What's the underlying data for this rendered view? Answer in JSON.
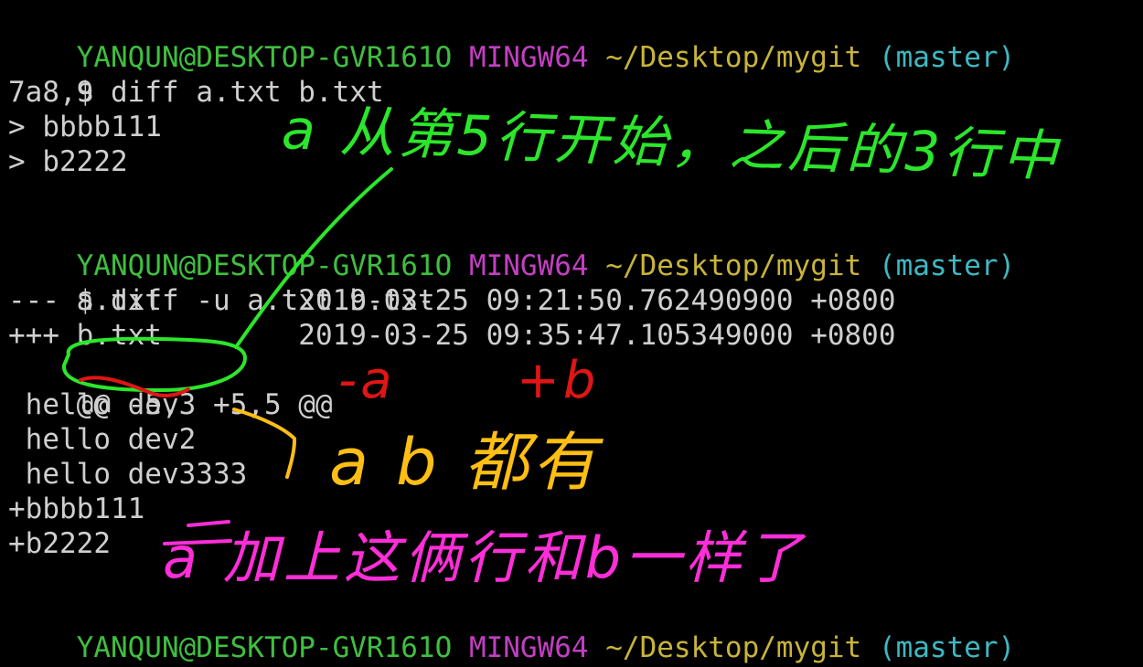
{
  "prompt": {
    "user_host": "YANQUN@DESKTOP-GVR161O",
    "system": "MINGW64",
    "path": "~/Desktop/mygit",
    "branch": "(master)",
    "symbol": "$"
  },
  "commands": {
    "cmd1": "diff a.txt b.txt",
    "cmd2": "diff -u a.txt b.txt"
  },
  "output1": {
    "line1": "7a8,9",
    "line2": "> bbbb111",
    "line3": "> b2222"
  },
  "output2": {
    "header_a": "--- a.txt        2019-03-25 09:21:50.762490900 +0800",
    "header_b": "+++ b.txt        2019-03-25 09:35:47.105349000 +0800",
    "hunk_prefix": "@@ ",
    "hunk_range": "-5,3 +5,5",
    "hunk_suffix": " @@",
    "ctx1": " hello dev",
    "ctx2": " hello dev2",
    "ctx3": " hello dev3333",
    "add1": "+bbbb111",
    "add2": "+b2222"
  },
  "annotations": {
    "green": "a 从第5行开始，之后的3行中",
    "red_a": "-a",
    "red_b": "+b",
    "orange": "a b 都有",
    "pink": "a 加上这俩行和b一样了"
  },
  "colors": {
    "user_host": "#3fbf3f",
    "system": "#c23fc2",
    "path": "#c8b43a",
    "branch": "#3fb8c2",
    "text": "#cfcfcf",
    "annotation_green": "#2be62b",
    "annotation_red": "#e01515",
    "annotation_orange": "#ffbe14",
    "annotation_pink": "#ff2ed8"
  }
}
